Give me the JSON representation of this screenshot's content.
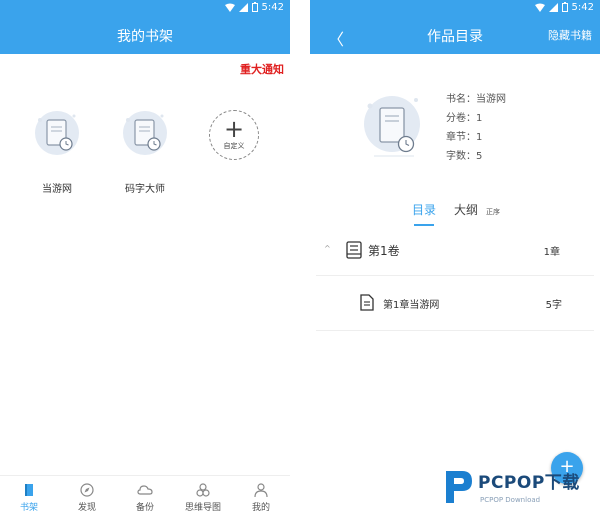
{
  "status_bar": {
    "time": "5:42"
  },
  "left": {
    "title": "我的书架",
    "notice": "重大通知",
    "books": [
      {
        "label": "当游网"
      },
      {
        "label": "码字大师"
      }
    ],
    "custom_label": "自定义",
    "custom_plus": "+",
    "nav": [
      {
        "label": "书架",
        "icon": "bookshelf-icon",
        "active": true
      },
      {
        "label": "发现",
        "icon": "compass-icon",
        "active": false
      },
      {
        "label": "备份",
        "icon": "cloud-icon",
        "active": false
      },
      {
        "label": "思维导图",
        "icon": "mindmap-icon",
        "active": false
      },
      {
        "label": "我的",
        "icon": "user-icon",
        "active": false
      }
    ]
  },
  "right": {
    "title": "作品目录",
    "back": "〈",
    "hide_label": "隐藏书籍",
    "info": {
      "name": "书名：当游网",
      "volumes": "分卷：1",
      "chapters": "章节：1",
      "words": "字数：5"
    },
    "tabs": {
      "toc": "目录",
      "outline": "大纲",
      "sort": "正序"
    },
    "volume": {
      "caret": "^",
      "label": "第1卷",
      "count": "1章"
    },
    "chapter": {
      "label": "第1章当游网",
      "count": "5字"
    },
    "fab": "+"
  },
  "watermark": {
    "brand": "PCPOP下载",
    "sub": "PCPOP Download"
  },
  "colors": {
    "accent": "#3aa3ec",
    "notice": "#e02020"
  }
}
